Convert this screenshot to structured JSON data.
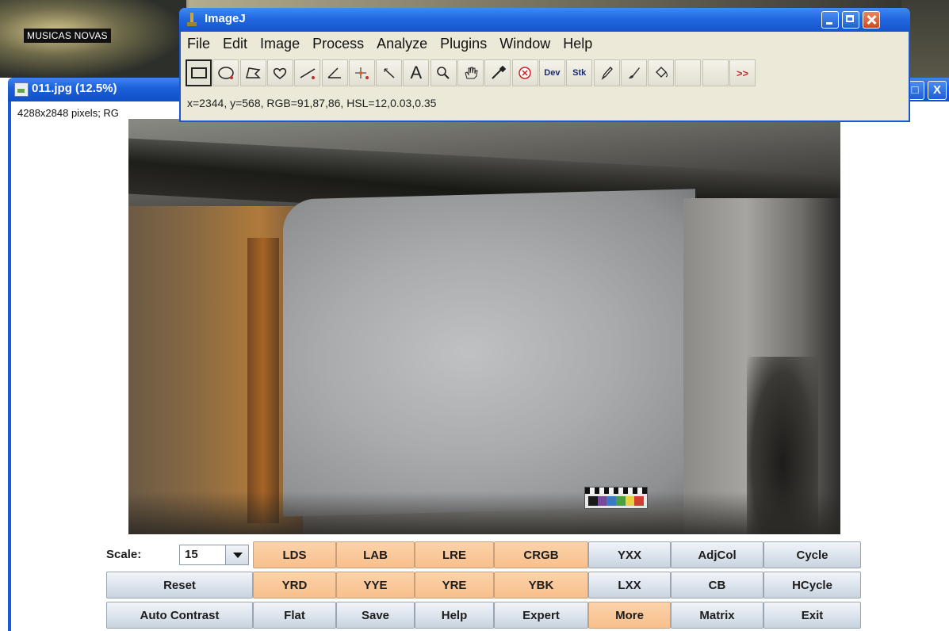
{
  "desktop": {
    "label": "MUSICAS NOVAS"
  },
  "image_window": {
    "title": "011.jpg (12.5%)",
    "info": "4288x2848 pixels; RG",
    "controls": [
      "□",
      "X"
    ]
  },
  "imagej": {
    "title": "ImageJ",
    "menu": [
      "File",
      "Edit",
      "Image",
      "Process",
      "Analyze",
      "Plugins",
      "Window",
      "Help"
    ],
    "tools": [
      {
        "name": "rectangle-tool-icon"
      },
      {
        "name": "oval-tool-icon"
      },
      {
        "name": "polygon-tool-icon"
      },
      {
        "name": "freehand-tool-icon"
      },
      {
        "name": "line-tool-icon"
      },
      {
        "name": "angle-tool-icon"
      },
      {
        "name": "point-tool-icon"
      },
      {
        "name": "wand-tool-icon"
      },
      {
        "name": "text-tool-icon",
        "label": "A"
      },
      {
        "name": "magnifier-tool-icon"
      },
      {
        "name": "hand-tool-icon"
      },
      {
        "name": "color-picker-icon"
      },
      {
        "name": "stop-icon"
      },
      {
        "name": "dev-tool-icon",
        "label": "Dev"
      },
      {
        "name": "stack-tool-icon",
        "label": "Stk"
      },
      {
        "name": "pencil-tool-icon"
      },
      {
        "name": "brush-tool-icon"
      },
      {
        "name": "flood-fill-tool-icon"
      },
      {
        "name": "empty-slot-1"
      },
      {
        "name": "empty-slot-2"
      },
      {
        "name": "more-tools-icon",
        "label": ">>"
      }
    ],
    "status": "x=2344, y=568, RGB=91,87,86, HSL=12,0.03,0.35"
  },
  "panel": {
    "scale_label": "Scale:",
    "scale_value": "15",
    "rows": [
      [
        {
          "label": "LDS",
          "color": "orange"
        },
        {
          "label": "LAB",
          "color": "orange"
        },
        {
          "label": "LRE",
          "color": "orange"
        },
        {
          "label": "CRGB",
          "color": "orange"
        },
        {
          "label": "YXX",
          "color": "blue"
        },
        {
          "label": "AdjCol",
          "color": "blue"
        },
        {
          "label": "Cycle",
          "color": "blue"
        }
      ],
      [
        {
          "label": "Reset",
          "color": "blue"
        },
        {
          "label": "YRD",
          "color": "orange"
        },
        {
          "label": "YYE",
          "color": "orange"
        },
        {
          "label": "YRE",
          "color": "orange"
        },
        {
          "label": "YBK",
          "color": "orange"
        },
        {
          "label": "LXX",
          "color": "blue"
        },
        {
          "label": "CB",
          "color": "blue"
        },
        {
          "label": "HCycle",
          "color": "blue"
        }
      ],
      [
        {
          "label": "Auto Contrast",
          "color": "blue"
        },
        {
          "label": "Flat",
          "color": "blue"
        },
        {
          "label": "Save",
          "color": "blue"
        },
        {
          "label": "Help",
          "color": "blue"
        },
        {
          "label": "Expert",
          "color": "blue"
        },
        {
          "label": "More",
          "color": "orange"
        },
        {
          "label": "Matrix",
          "color": "blue"
        },
        {
          "label": "Exit",
          "color": "blue"
        }
      ]
    ]
  },
  "colors": {
    "orange": "#f8bf8c",
    "blue": "#dbe3ec",
    "titlebar": "#2268e0"
  }
}
